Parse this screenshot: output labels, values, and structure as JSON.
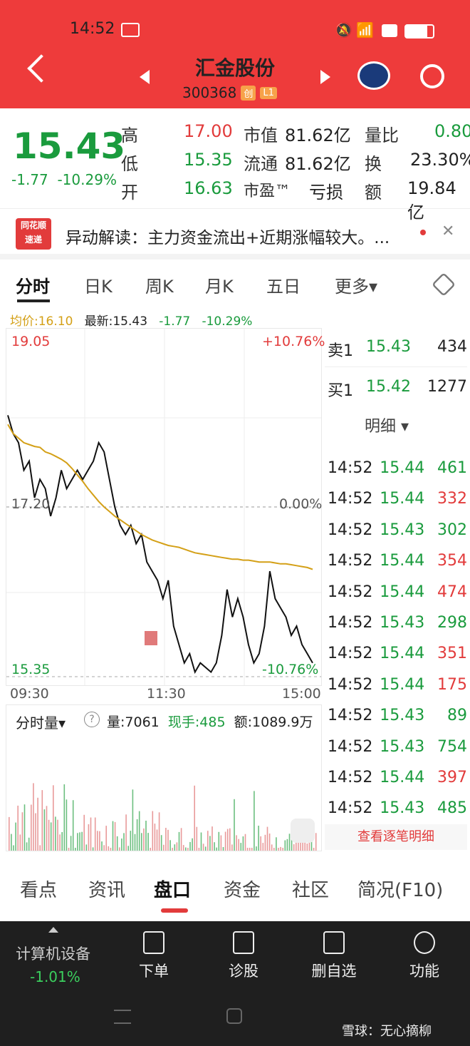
{
  "status_bar": {
    "time": "14:52"
  },
  "header": {
    "stock_name": "汇金股份",
    "code": "300368",
    "tag_chuang": "创",
    "tag_l1": "L1"
  },
  "quote": {
    "price": "15.43",
    "change": "-1.77",
    "change_pct": "-10.29%",
    "high_label": "高",
    "high": "17.00",
    "low_label": "低",
    "low": "15.35",
    "open_label": "开",
    "open": "16.63",
    "mcap_label": "市值",
    "mcap": "81.62亿",
    "float_label": "流通",
    "float": "81.62亿",
    "pe_label": "市盈™",
    "pe": "亏损",
    "vol_ratio_label": "量比",
    "vol_ratio": "0.80",
    "turnover_label": "换",
    "turnover": "23.30%",
    "amount_label": "额",
    "amount": "19.84亿"
  },
  "news": {
    "logo_top": "同花顺",
    "logo_bottom": "速递",
    "text": "异动解读：主力资金流出+近期涨幅较大。..."
  },
  "chart_tabs": [
    "分时",
    "日K",
    "周K",
    "月K",
    "五日",
    "更多▾"
  ],
  "chart_info": {
    "avg": "均价:16.10",
    "latest": "最新:15.43",
    "chg": "-1.77",
    "chg_pct": "-10.29%"
  },
  "chart_data": {
    "type": "line",
    "title": "",
    "y_labels": {
      "top": "19.05",
      "mid": "17.20",
      "bottom": "15.35",
      "top_pct": "+10.76%",
      "mid_pct": "0.00%",
      "bottom_pct": "-10.76%"
    },
    "x_labels": [
      "09:30",
      "11:30",
      "15:00"
    ],
    "ylim": [
      15.35,
      19.05
    ],
    "series": [
      {
        "values": [
          18.2,
          18.0,
          17.9,
          17.6,
          17.7,
          17.3,
          17.5,
          17.4,
          17.1,
          17.3,
          17.6,
          17.4,
          17.5,
          17.6,
          17.5,
          17.6,
          17.7,
          17.9,
          17.8,
          17.5,
          17.2,
          17.0,
          16.9,
          17.0,
          16.8,
          16.9,
          16.6,
          16.5,
          16.4,
          16.2,
          16.4,
          15.9,
          15.7,
          15.5,
          15.6,
          15.4,
          15.5,
          15.45,
          15.4,
          15.5,
          15.8,
          16.3,
          16.0,
          16.2,
          16.0,
          15.7,
          15.5,
          15.6,
          15.9,
          16.5,
          16.2,
          16.1,
          16.0,
          15.8,
          15.9,
          15.7,
          15.6,
          15.5
        ]
      },
      {
        "values": [
          18.1,
          18.0,
          17.95,
          17.9,
          17.88,
          17.86,
          17.85,
          17.8,
          17.78,
          17.75,
          17.72,
          17.68,
          17.62,
          17.55,
          17.48,
          17.4,
          17.33,
          17.26,
          17.2,
          17.15,
          17.1,
          17.06,
          17.02,
          16.98,
          16.94,
          16.9,
          16.87,
          16.84,
          16.82,
          16.8,
          16.78,
          16.77,
          16.76,
          16.74,
          16.72,
          16.7,
          16.69,
          16.68,
          16.67,
          16.66,
          16.65,
          16.64,
          16.63,
          16.63,
          16.62,
          16.62,
          16.61,
          16.6,
          16.6,
          16.6,
          16.59,
          16.58,
          16.58,
          16.57,
          16.56,
          16.55,
          16.54,
          16.52
        ]
      }
    ]
  },
  "volume": {
    "label": "分时量▾",
    "help": "?",
    "vol": "量:7061",
    "hand": "现手:485",
    "amount": "额:1089.9万"
  },
  "order_book": {
    "sell1": {
      "label": "卖1",
      "price": "15.43",
      "qty": "434"
    },
    "buy1": {
      "label": "买1",
      "price": "15.42",
      "qty": "1277"
    },
    "detail_label": "明细 ▾",
    "ticks": [
      {
        "time": "14:52",
        "price": "15.44",
        "qty": "461",
        "c": "g"
      },
      {
        "time": "14:52",
        "price": "15.44",
        "qty": "332",
        "c": "r"
      },
      {
        "time": "14:52",
        "price": "15.43",
        "qty": "302",
        "c": "g"
      },
      {
        "time": "14:52",
        "price": "15.44",
        "qty": "354",
        "c": "r"
      },
      {
        "time": "14:52",
        "price": "15.44",
        "qty": "474",
        "c": "r"
      },
      {
        "time": "14:52",
        "price": "15.43",
        "qty": "298",
        "c": "g"
      },
      {
        "time": "14:52",
        "price": "15.44",
        "qty": "351",
        "c": "r"
      },
      {
        "time": "14:52",
        "price": "15.44",
        "qty": "175",
        "c": "r"
      },
      {
        "time": "14:52",
        "price": "15.43",
        "qty": "89",
        "c": "g"
      },
      {
        "time": "14:52",
        "price": "15.43",
        "qty": "754",
        "c": "g"
      },
      {
        "time": "14:52",
        "price": "15.44",
        "qty": "397",
        "c": "r"
      },
      {
        "time": "14:52",
        "price": "15.43",
        "qty": "485",
        "c": "g"
      }
    ],
    "view_all": "查看逐笔明细"
  },
  "bottom_tabs": [
    "看点",
    "资讯",
    "盘口",
    "资金",
    "社区",
    "简况(F10)"
  ],
  "navbar": {
    "sector": "计算机设备",
    "sector_chg": "-1.01%",
    "items": [
      "下单",
      "诊股",
      "删自选",
      "功能"
    ],
    "watermark": "雪球：无心摘柳"
  },
  "colors": {
    "brand": "#ee3b3b",
    "down": "#1a9b3d",
    "up": "#e23b3b",
    "avg_line": "#d4a017"
  }
}
